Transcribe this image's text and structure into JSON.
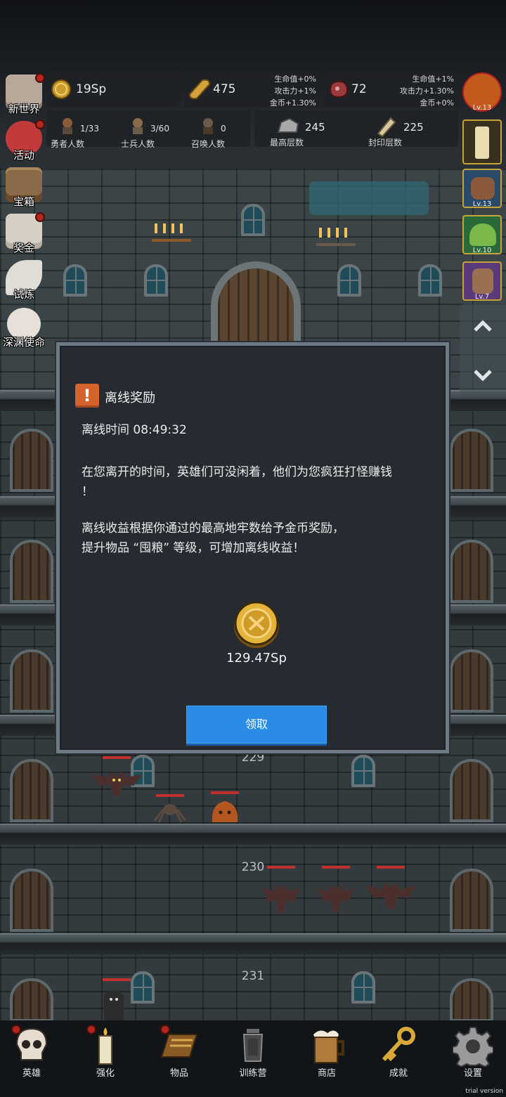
{
  "hud": {
    "currency": {
      "value": "19Sp",
      "icon": "gold-coin-icon"
    },
    "bread": {
      "value": "475",
      "bonus_lines": [
        "生命值+0%",
        "攻击力+1%",
        "金币+1.30%"
      ],
      "icon": "bread-icon"
    },
    "meat": {
      "value": "72",
      "bonus_lines": [
        "生命值+1%",
        "攻击力+1.30%",
        "金币+0%"
      ],
      "icon": "meat-icon"
    },
    "heroes": {
      "count": "1/33",
      "label": "勇者人数"
    },
    "soldiers": {
      "count": "3/60",
      "label": "士兵人数"
    },
    "summons": {
      "count": "0",
      "label": "召唤人数"
    },
    "max_floor": {
      "value": "245",
      "label": "最高层数"
    },
    "sealed_floor": {
      "value": "225",
      "label": "封印层数"
    }
  },
  "left_menu": [
    {
      "label": "新世界",
      "icon": "castle-icon",
      "badge": true
    },
    {
      "label": "活动",
      "icon": "heart-icon",
      "badge": true
    },
    {
      "label": "宝箱",
      "icon": "treasure-chest-icon",
      "badge": false
    },
    {
      "label": "奖金",
      "icon": "envelope-icon",
      "badge": true
    },
    {
      "label": "试炼",
      "icon": "feather-icon",
      "badge": false
    },
    {
      "label": "深渊使命",
      "icon": "crystal-ball-icon",
      "badge": false
    }
  ],
  "right_slots": [
    {
      "level": "Lv.13",
      "icon": "pumpkin-icon"
    },
    {
      "level": "",
      "icon": "candle-icon"
    },
    {
      "level": "Lv.13",
      "icon": "sack-icon"
    },
    {
      "level": "Lv.10",
      "icon": "slime-icon"
    },
    {
      "level": "Lv.7",
      "icon": "hero-portrait-icon"
    }
  ],
  "floors": [
    "229",
    "230",
    "231"
  ],
  "modal": {
    "title": "离线奖励",
    "offline_time": "离线时间 08:49:32",
    "line1": "在您离开的时间，英雄们可没闲着，他们为您疯狂打怪赚钱",
    "line1b": "！",
    "line2": "离线收益根据你通过的最高地牢数给予金币奖励，",
    "line3": "提升物品 “囤粮” 等级，可增加离线收益！",
    "reward": "129.47Sp",
    "button": "领取"
  },
  "bottom_nav": [
    {
      "label": "英雄",
      "icon": "skull-icon",
      "badge": true
    },
    {
      "label": "强化",
      "icon": "candle-icon",
      "badge": true
    },
    {
      "label": "物品",
      "icon": "book-icon",
      "badge": true
    },
    {
      "label": "训练营",
      "icon": "lantern-icon",
      "badge": false
    },
    {
      "label": "商店",
      "icon": "beer-mug-icon",
      "badge": false
    },
    {
      "label": "成就",
      "icon": "key-icon",
      "badge": false
    },
    {
      "label": "设置",
      "icon": "gear-icon",
      "badge": false
    }
  ],
  "watermark": "trial version",
  "colors": {
    "accent_button": "#2b8ce6",
    "warning_icon": "#d5632e",
    "badge_red": "#b3261e",
    "hp_bar": "#c0302c"
  }
}
